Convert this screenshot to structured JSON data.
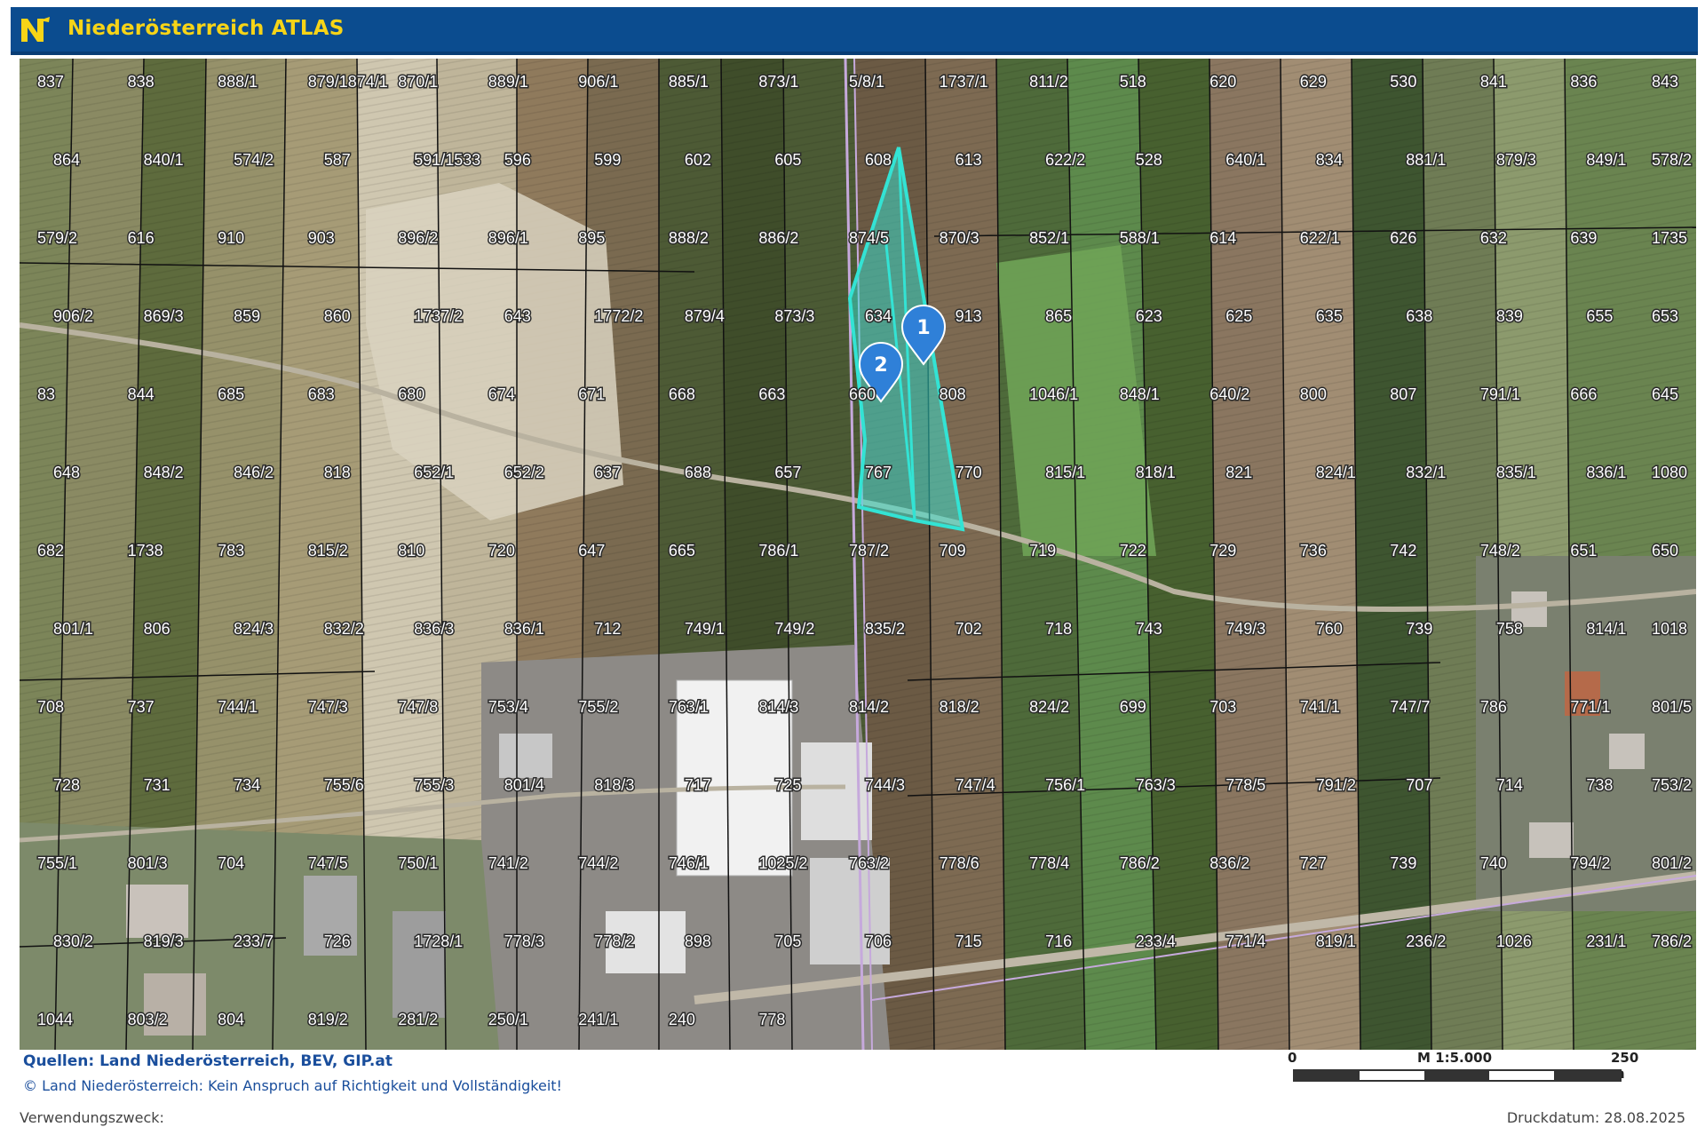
{
  "header": {
    "title": "Niederösterreich ATLAS",
    "logo": "N-logo"
  },
  "map": {
    "highlight_color": "#33e3d4",
    "markers": [
      {
        "label": "1"
      },
      {
        "label": "2"
      }
    ],
    "parcel_labels": [
      "837",
      "838",
      "888/1",
      "879/1874/1",
      "870/1",
      "889/1",
      "906/1",
      "885/1",
      "873/1",
      "5/8/1",
      "1737/1",
      "811/2",
      "518",
      "620",
      "629",
      "530",
      "841",
      "836",
      "843",
      "864",
      "840/1",
      "574/2",
      "587",
      "591/1533",
      "596",
      "599",
      "602",
      "605",
      "608",
      "613",
      "622/2",
      "528",
      "640/1",
      "834",
      "881/1",
      "879/3",
      "849/1",
      "578/2",
      "579/2",
      "616",
      "910",
      "903",
      "896/2",
      "896/1",
      "895",
      "888/2",
      "886/2",
      "874/5",
      "870/3",
      "852/1",
      "588/1",
      "614",
      "622/1",
      "626",
      "632",
      "639",
      "1735",
      "906/2",
      "869/3",
      "859",
      "860",
      "1737/2",
      "643",
      "1772/2",
      "879/4",
      "873/3",
      "634",
      "913",
      "865",
      "623",
      "625",
      "635",
      "638",
      "839",
      "655",
      "653",
      "83",
      "844",
      "685",
      "683",
      "680",
      "674",
      "671",
      "668",
      "663",
      "660",
      "808",
      "1046/1",
      "848/1",
      "640/2",
      "800",
      "807",
      "791/1",
      "666",
      "645",
      "648",
      "848/2",
      "846/2",
      "818",
      "652/1",
      "652/2",
      "637",
      "688",
      "657",
      "767",
      "770",
      "815/1",
      "818/1",
      "821",
      "824/1",
      "832/1",
      "835/1",
      "836/1",
      "1080",
      "682",
      "1738",
      "783",
      "815/2",
      "810",
      "720",
      "647",
      "665",
      "786/1",
      "787/2",
      "709",
      "719",
      "722",
      "729",
      "736",
      "742",
      "748/2",
      "651",
      "650",
      "801/1",
      "806",
      "824/3",
      "832/2",
      "836/3",
      "836/1",
      "712",
      "749/1",
      "749/2",
      "835/2",
      "702",
      "718",
      "743",
      "749/3",
      "760",
      "739",
      "758",
      "814/1",
      "1018",
      "708",
      "737",
      "744/1",
      "747/3",
      "747/8",
      "753/4",
      "755/2",
      "763/1",
      "814/3",
      "814/2",
      "818/2",
      "824/2",
      "699",
      "703",
      "741/1",
      "747/7",
      "786",
      "771/1",
      "801/5",
      "728",
      "731",
      "734",
      "755/6",
      "755/3",
      "801/4",
      "818/3",
      "717",
      "725",
      "744/3",
      "747/4",
      "756/1",
      "763/3",
      "778/5",
      "791/2",
      "707",
      "714",
      "738",
      "753/2",
      "755/1",
      "801/3",
      "704",
      "747/5",
      "750/1",
      "741/2",
      "744/2",
      "746/1",
      "1025/2",
      "763/2",
      "778/6",
      "778/4",
      "786/2",
      "836/2",
      "727",
      "739",
      "740",
      "794/2",
      "801/2",
      "830/2",
      "819/3",
      "233/7",
      "726",
      "1728/1",
      "778/3",
      "778/2",
      "898",
      "705",
      "706",
      "715",
      "716",
      "233/4",
      "771/4",
      "819/1",
      "236/2",
      "1026",
      "231/1",
      "786/2",
      "1044",
      "803/2",
      "804",
      "819/2",
      "281/2",
      "250/1",
      "241/1",
      "240",
      "778"
    ]
  },
  "footer": {
    "sources": "Quellen: Land Niederösterreich, BEV, GIP.at",
    "copyright": "© Land Niederösterreich: Kein Anspruch auf Richtigkeit und Vollständigkeit!",
    "purpose_label": "Verwendungszweck:",
    "print_date": "Druckdatum: 28.08.2025",
    "scale": {
      "start": "0",
      "ratio": "M 1:5.000",
      "end": "250 m"
    }
  }
}
